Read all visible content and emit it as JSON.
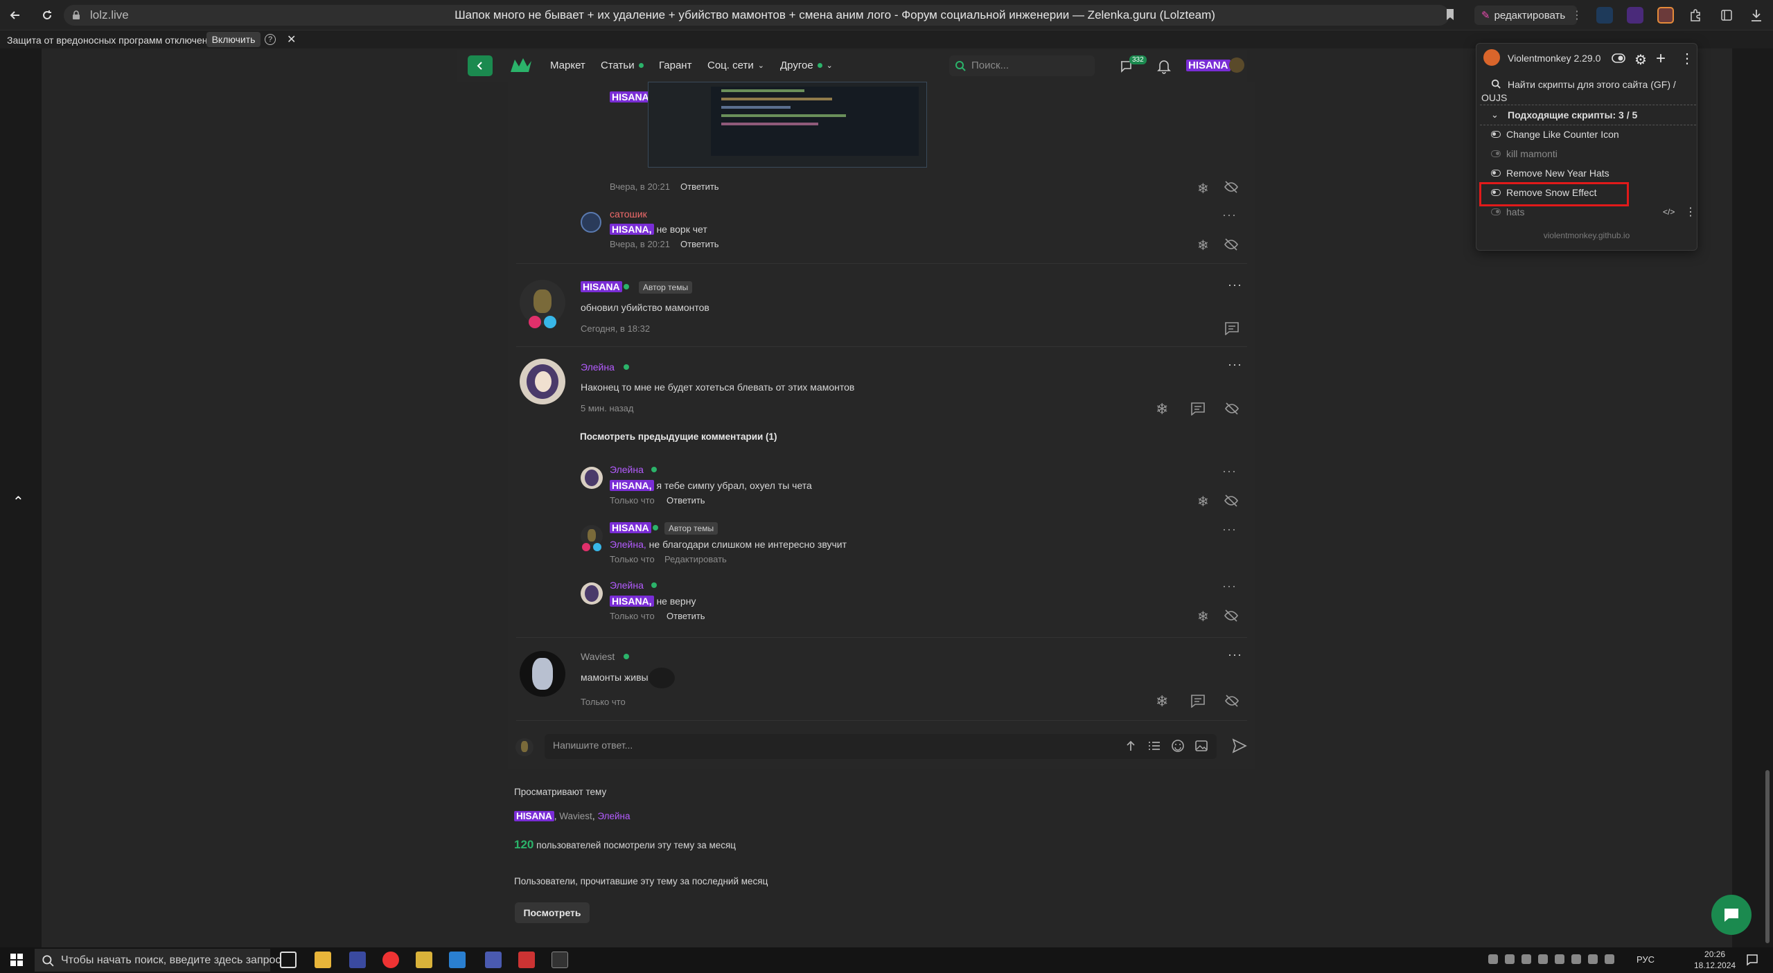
{
  "browser": {
    "url": "lolz.live",
    "tab_title": "Шапок много не бывает + их удаление + убийство мамонтов + смена аним лого - Форум социальной инженерии — Zelenka.guru (Lolzteam)",
    "edit_label": "редактировать",
    "protection_text": "Защита от вредоносных программ отключена",
    "protection_button": "Включить",
    "protection_help": "?",
    "protection_close": "✕"
  },
  "header": {
    "nav": [
      "Маркет",
      "Статьи",
      "Гарант",
      "Соц. сети",
      "Другое"
    ],
    "search_placeholder": "Поиск...",
    "messages_badge": "332",
    "username": "HISANA"
  },
  "thread": {
    "item0": {
      "mention": "HISANA,",
      "time": "Вчера, в 20:21",
      "reply": "Ответить"
    },
    "item1": {
      "author": "сатошик",
      "mention": "HISANA,",
      "text": "не ворк чет",
      "time": "Вчера, в 20:21",
      "reply": "Ответить"
    },
    "post1": {
      "author": "HISANA",
      "badge": "Автор темы",
      "text": "обновил убийство мамонтов",
      "time": "Сегодня, в 18:32"
    },
    "post2": {
      "author": "Элейна",
      "text": "Наконец то мне не будет хотеться блевать от этих мамонтов",
      "time": "5 мин. назад",
      "more": "Посмотреть предыдущие комментарии (1)"
    },
    "c1": {
      "author": "Элейна",
      "mention": "HISANA,",
      "text": "я тебе симпу убрал, охуел ты чета",
      "time": "Только что",
      "reply": "Ответить"
    },
    "c2": {
      "author": "HISANA",
      "badge": "Автор темы",
      "mention": "Элейна,",
      "text": "не благодари слишком не интересно звучит",
      "time": "Только что",
      "edit": "Редактировать"
    },
    "c3": {
      "author": "Элейна",
      "mention": "HISANA,",
      "text": "не верну",
      "time": "Только что",
      "reply": "Ответить"
    },
    "post3": {
      "author": "Waviest",
      "text": "мамонты живы(",
      "time": "Только что"
    },
    "reply_placeholder": "Напишите ответ..."
  },
  "viewers": {
    "title": "Просматривают тему",
    "list": [
      "HISANA",
      "Waviest",
      "Элейна"
    ],
    "sep1": ",",
    "sep2": ",",
    "count": "120",
    "count_text": "пользователей посмотрели эту тему за месяц",
    "monthly_title": "Пользователи, прочитавшие эту тему за последний месяц",
    "view_button": "Посмотреть"
  },
  "violentmonkey": {
    "title": "Violentmonkey 2.29.0",
    "find_scripts": "Найти скрипты для этого сайта (GF)  /",
    "find_scripts_2": "OUJS",
    "matching_label": "Подходящие скрипты: 3 / 5",
    "scripts": [
      {
        "name": "Change Like Counter Icon",
        "enabled": true
      },
      {
        "name": "kill mamonti",
        "enabled": false
      },
      {
        "name": "Remove New Year Hats",
        "enabled": true
      },
      {
        "name": "Remove Snow Effect",
        "enabled": true
      },
      {
        "name": "hats",
        "enabled": false
      }
    ],
    "footer": "violentmonkey.github.io"
  },
  "taskbar": {
    "search_placeholder": "Чтобы начать поиск, введите здесь запрос",
    "lang": "РУС",
    "time": "20:26",
    "date": "18.12.2024"
  },
  "colors": {
    "accent_green": "#1b8a4f",
    "nick_purple": "#b45cff",
    "highlight_red": "#e11a1a"
  }
}
